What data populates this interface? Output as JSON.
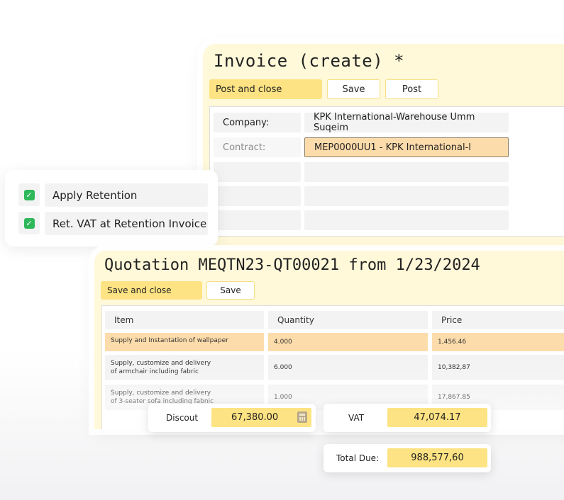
{
  "invoice": {
    "title": "Invoice (create) *",
    "buttons": {
      "post_and_close": "Post and close",
      "save": "Save",
      "post": "Post"
    },
    "fields": [
      {
        "label": "Company:",
        "value": "KPK International-Warehouse Umm Suqeim"
      },
      {
        "label": "Contract:",
        "value": "MEP0000UU1 - KPK International-l"
      }
    ]
  },
  "retention": {
    "items": [
      {
        "label": "Apply Retention",
        "checked": true
      },
      {
        "label": "Ret. VAT at Retention Invoice",
        "checked": true
      }
    ]
  },
  "quotation": {
    "title": "Quotation MEQTN23-QT00021 from 1/23/2024",
    "buttons": {
      "save_and_close": "Save and close",
      "save": "Save"
    },
    "columns": [
      "Item",
      "Quantity",
      "Price"
    ],
    "rows": [
      {
        "item": "Supply and Instantation of wallpaper",
        "quantity": "4.000",
        "price": "1,456.46"
      },
      {
        "item": "Supply, customize and delivery\nof armchair including fabric",
        "quantity": "6.000",
        "price": "10,382,87"
      },
      {
        "item": "Supply, customize and delivery\nof 3-seater sofa including fabnic",
        "quantity": "1.000",
        "price": "17,867.85"
      }
    ]
  },
  "summary": {
    "discount": {
      "label": "Discout",
      "value": "67,380.00",
      "icon": "calculator-icon"
    },
    "vat": {
      "label": "VAT",
      "value": "47,074.17"
    },
    "total_due": {
      "label": "Total Due:",
      "value": "988,577,60"
    }
  },
  "colors": {
    "card_bg": "#fff8d9",
    "primary_button": "#fde383",
    "highlight": "#fddcab",
    "check_green": "#2fb85a"
  }
}
